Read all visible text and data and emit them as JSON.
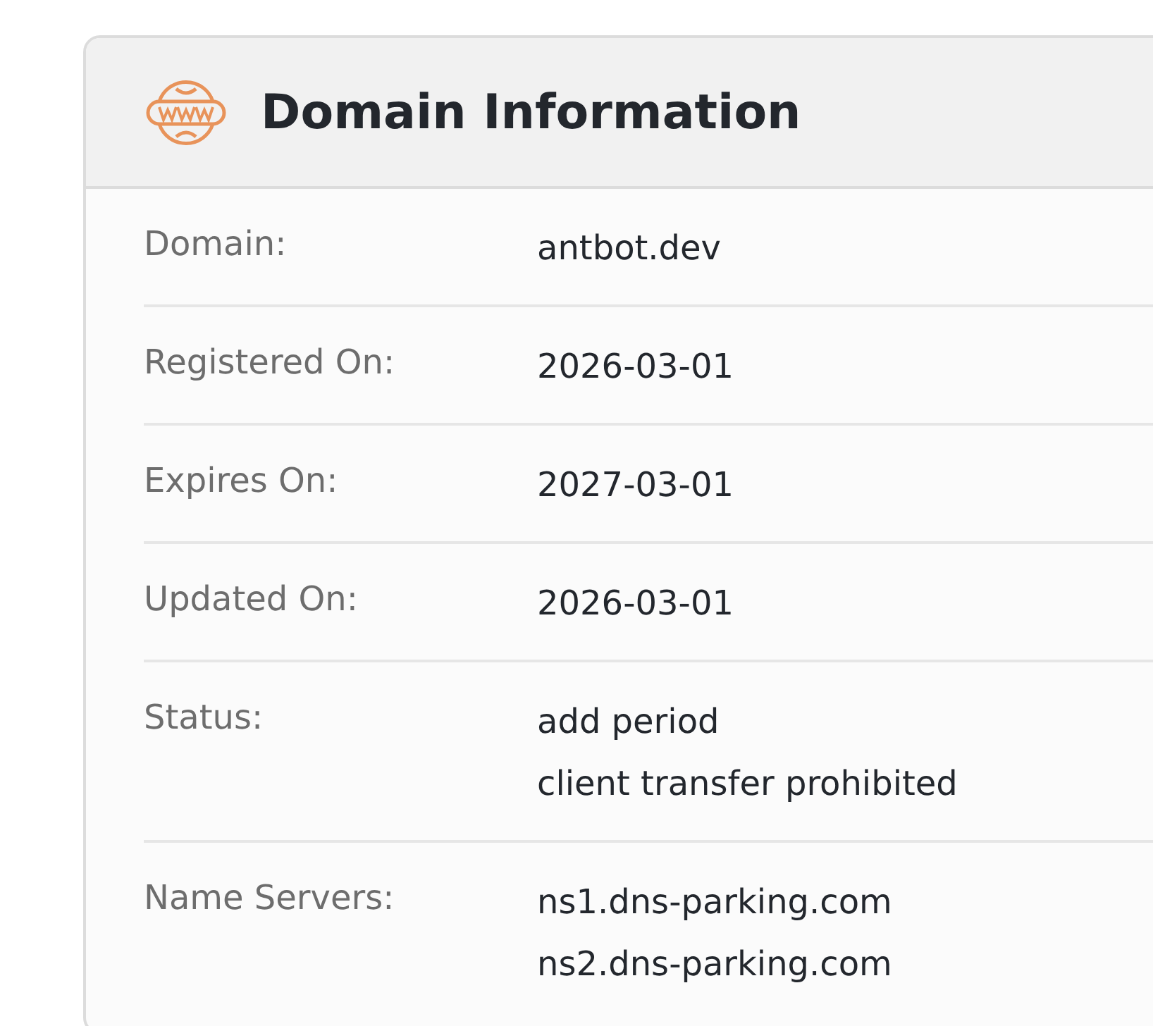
{
  "panel": {
    "title": "Domain Information"
  },
  "rows": [
    {
      "label": "Domain:",
      "values": [
        "antbot.dev"
      ]
    },
    {
      "label": "Registered On:",
      "values": [
        "2026-03-01"
      ]
    },
    {
      "label": "Expires On:",
      "values": [
        "2027-03-01"
      ]
    },
    {
      "label": "Updated On:",
      "values": [
        "2026-03-01"
      ]
    },
    {
      "label": "Status:",
      "values": [
        "add period",
        "client transfer prohibited"
      ]
    },
    {
      "label": "Name Servers:",
      "values": [
        "ns1.dns-parking.com",
        "ns2.dns-parking.com"
      ]
    }
  ]
}
